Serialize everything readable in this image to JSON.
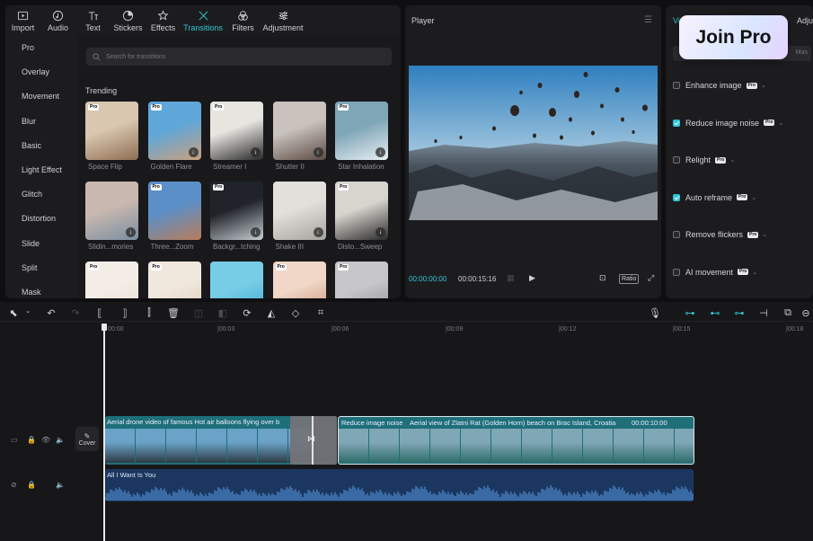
{
  "toolbar": {
    "items": [
      {
        "label": "Import",
        "icon": "import-icon"
      },
      {
        "label": "Audio",
        "icon": "audio-icon"
      },
      {
        "label": "Text",
        "icon": "text-icon"
      },
      {
        "label": "Stickers",
        "icon": "stickers-icon"
      },
      {
        "label": "Effects",
        "icon": "effects-icon"
      },
      {
        "label": "Transitions",
        "icon": "transitions-icon",
        "active": true
      },
      {
        "label": "Filters",
        "icon": "filters-icon"
      },
      {
        "label": "Adjustment",
        "icon": "adjustment-icon"
      }
    ],
    "accent": "#2ec6d6"
  },
  "sidebar": {
    "items": [
      "Pro",
      "Overlay",
      "Movement",
      "Blur",
      "Basic",
      "Light Effect",
      "Glitch",
      "Distortion",
      "Slide",
      "Split",
      "Mask"
    ]
  },
  "search": {
    "placeholder": "Search for transitions"
  },
  "section_title": "Trending",
  "cards": [
    {
      "label": "Space Flip",
      "pro": true,
      "download": false
    },
    {
      "label": "Golden Flare",
      "pro": true,
      "download": true
    },
    {
      "label": "Streamer I",
      "pro": true,
      "download": true
    },
    {
      "label": "Shutter II",
      "pro": false,
      "download": true
    },
    {
      "label": "Star Inhalation",
      "pro": true,
      "download": true
    },
    {
      "label": "Slidin...mories",
      "pro": false,
      "download": true
    },
    {
      "label": "Three...Zoom",
      "pro": true,
      "download": false
    },
    {
      "label": "Backgr...tching",
      "pro": true,
      "download": true
    },
    {
      "label": "Shake III",
      "pro": false,
      "download": true
    },
    {
      "label": "Disto...Sweep",
      "pro": true,
      "download": true
    },
    {
      "label": "",
      "pro": true,
      "download": false
    },
    {
      "label": "",
      "pro": true,
      "download": false
    },
    {
      "label": "",
      "pro": false,
      "download": false
    },
    {
      "label": "",
      "pro": true,
      "download": false
    },
    {
      "label": "",
      "pro": true,
      "download": false
    }
  ],
  "player": {
    "title": "Player",
    "current_time": "00:00:00:00",
    "total_time": "00:00:15:16",
    "ratio_label": "Ratio"
  },
  "details": {
    "tab_left": "Vi",
    "tab_right": "Adju",
    "field_value": "Mas",
    "join_pro": "Join Pro",
    "pro_badge": "Pro",
    "options": [
      {
        "label": "Enhance image",
        "checked": false
      },
      {
        "label": "Reduce image noise",
        "checked": true
      },
      {
        "label": "Relight",
        "checked": false
      },
      {
        "label": "Auto reframe",
        "checked": true
      },
      {
        "label": "Remove flickers",
        "checked": false
      },
      {
        "label": "AI movement",
        "checked": false
      }
    ]
  },
  "timeline": {
    "ruler": [
      "00:00",
      "|00:03",
      "|00:06",
      "|00:09",
      "|00:12",
      "|00:15",
      "|00:18"
    ],
    "cover_label": "Cover",
    "clip1_title": "Aerial drone video of famous Hot air balloons flying over b",
    "clip2_effect": "Reduce image noise",
    "clip2_title": "Aerial view of Zlatni Rat (Golden Horn) beach on Brac Island, Croatia",
    "clip2_duration": "00:00:10:00",
    "audio_title": "All I Want Is You"
  }
}
